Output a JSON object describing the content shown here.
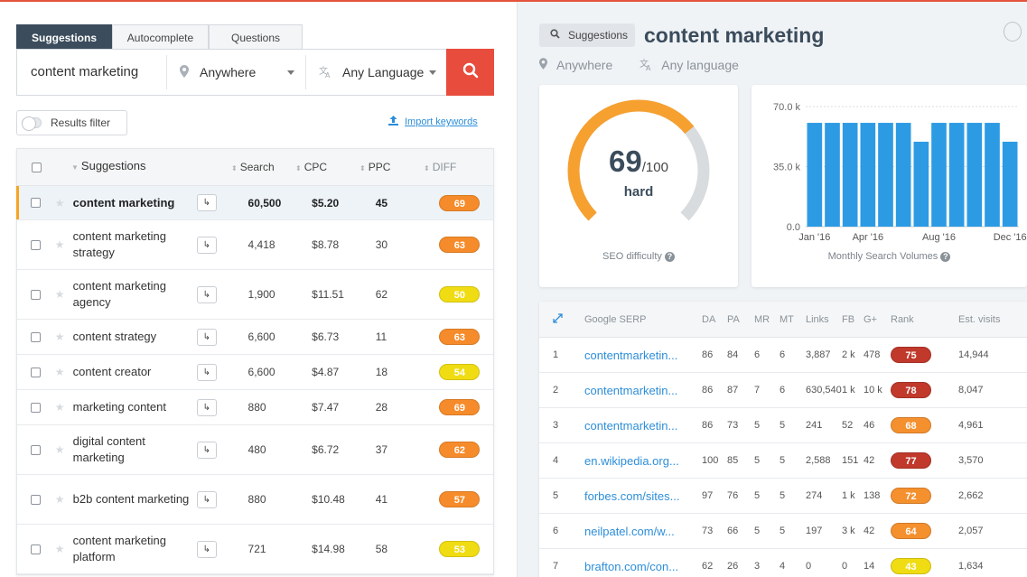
{
  "search": {
    "tabs": [
      "Suggestions",
      "Autocomplete",
      "Questions"
    ],
    "keyword": "content marketing",
    "location": "Anywhere",
    "language": "Any Language",
    "results_filter_label": "Results filter",
    "import_label": "Import keywords"
  },
  "table": {
    "headers": {
      "keyword": "Suggestions",
      "search": "Search",
      "cpc": "CPC",
      "ppc": "PPC",
      "diff": "DIFF"
    },
    "rows": [
      {
        "kw": "content marketing",
        "search": "60,500",
        "cpc": "$5.20",
        "ppc": "45",
        "diff": "69"
      },
      {
        "kw": "content marketing strategy",
        "search": "4,418",
        "cpc": "$8.78",
        "ppc": "30",
        "diff": "63"
      },
      {
        "kw": "content marketing agency",
        "search": "1,900",
        "cpc": "$11.51",
        "ppc": "62",
        "diff": "50"
      },
      {
        "kw": "content strategy",
        "search": "6,600",
        "cpc": "$6.73",
        "ppc": "11",
        "diff": "63"
      },
      {
        "kw": "content creator",
        "search": "6,600",
        "cpc": "$4.87",
        "ppc": "18",
        "diff": "54"
      },
      {
        "kw": "marketing content",
        "search": "880",
        "cpc": "$7.47",
        "ppc": "28",
        "diff": "69"
      },
      {
        "kw": "digital content marketing",
        "search": "480",
        "cpc": "$6.72",
        "ppc": "37",
        "diff": "62"
      },
      {
        "kw": "b2b content marketing",
        "search": "880",
        "cpc": "$10.48",
        "ppc": "41",
        "diff": "57"
      },
      {
        "kw": "content marketing platform",
        "search": "721",
        "cpc": "$14.98",
        "ppc": "58",
        "diff": "53"
      }
    ]
  },
  "detail": {
    "button": "Suggestions",
    "title": "content marketing",
    "location": "Anywhere",
    "language": "Any language",
    "seo_score": "69",
    "seo_max": "/100",
    "seo_level": "hard",
    "seo_caption": "SEO difficulty",
    "volume_caption": "Monthly Search Volumes"
  },
  "chart_data": {
    "type": "bar",
    "categories": [
      "Jan '16",
      "Feb '16",
      "Mar '16",
      "Apr '16",
      "May '16",
      "Jun '16",
      "Jul '16",
      "Aug '16",
      "Sep '16",
      "Oct '16",
      "Nov '16",
      "Dec '16"
    ],
    "x_tick_labels": [
      "Jan '16",
      "Apr '16",
      "Aug '16",
      "Dec '16"
    ],
    "values": [
      60500,
      60500,
      60500,
      60500,
      60500,
      60500,
      49500,
      60500,
      60500,
      60500,
      60500,
      49500
    ],
    "y_tick_labels": [
      "70.0 k",
      "35.0 k",
      "0.0"
    ],
    "ylim": [
      0,
      70000
    ],
    "color": "#2d9be3"
  },
  "serp": {
    "headers": [
      "Google SERP",
      "DA",
      "PA",
      "MR",
      "MT",
      "Links",
      "FB",
      "G+",
      "Rank",
      "Est. visits"
    ],
    "rows": [
      {
        "n": "1",
        "url": "contentmarketin...",
        "da": "86",
        "pa": "84",
        "mr": "6",
        "mt": "6",
        "links": "3,887",
        "fb": "2 k",
        "gp": "478",
        "rank": "75",
        "visits": "14,944"
      },
      {
        "n": "2",
        "url": "contentmarketin...",
        "da": "86",
        "pa": "87",
        "mr": "7",
        "mt": "6",
        "links": "630,540",
        "fb": "1 k",
        "gp": "10 k",
        "rank": "78",
        "visits": "8,047"
      },
      {
        "n": "3",
        "url": "contentmarketin...",
        "da": "86",
        "pa": "73",
        "mr": "5",
        "mt": "5",
        "links": "241",
        "fb": "52",
        "gp": "46",
        "rank": "68",
        "visits": "4,961"
      },
      {
        "n": "4",
        "url": "en.wikipedia.org...",
        "da": "100",
        "pa": "85",
        "mr": "5",
        "mt": "5",
        "links": "2,588",
        "fb": "151",
        "gp": "42",
        "rank": "77",
        "visits": "3,570"
      },
      {
        "n": "5",
        "url": "forbes.com/sites...",
        "da": "97",
        "pa": "76",
        "mr": "5",
        "mt": "5",
        "links": "274",
        "fb": "1 k",
        "gp": "138",
        "rank": "72",
        "visits": "2,662"
      },
      {
        "n": "6",
        "url": "neilpatel.com/w...",
        "da": "73",
        "pa": "66",
        "mr": "5",
        "mt": "5",
        "links": "197",
        "fb": "3 k",
        "gp": "42",
        "rank": "64",
        "visits": "2,057"
      },
      {
        "n": "7",
        "url": "brafton.com/con...",
        "da": "62",
        "pa": "26",
        "mr": "3",
        "mt": "4",
        "links": "0",
        "fb": "0",
        "gp": "14",
        "rank": "43",
        "visits": "1,634"
      }
    ]
  },
  "colors": {
    "accent_red": "#e84c3d",
    "gauge_orange": "#f6a030",
    "gauge_grey": "#d9dcdf",
    "diff_yellow": "#f0dc12",
    "diff_orange": "#f58b2a",
    "rank_red": "#c0392b",
    "rank_orange": "#f5902e",
    "link_blue": "#2d8ed9"
  }
}
